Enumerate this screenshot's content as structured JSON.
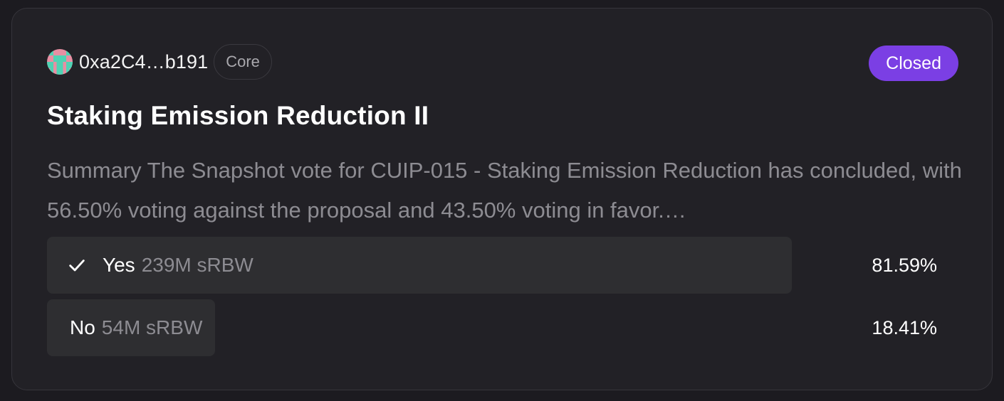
{
  "proposal": {
    "author": "0xa2C4…b191",
    "space_tag": "Core",
    "status": "Closed",
    "status_color": "#7b3fe4",
    "title": "Staking Emission Reduction II",
    "summary": "Summary The Snapshot vote for CUIP-015 - Staking Emission Reduction has concluded, with 56.50% voting against the proposal and 43.50% voting in favor.…",
    "choices": [
      {
        "label": "Yes",
        "amount": "239M sRBW",
        "percent": "81.59%",
        "share": 0.8159,
        "selected": true,
        "icon": "check-icon"
      },
      {
        "label": "No",
        "amount": "54M sRBW",
        "percent": "18.41%",
        "share": 0.1841,
        "selected": false
      }
    ]
  }
}
